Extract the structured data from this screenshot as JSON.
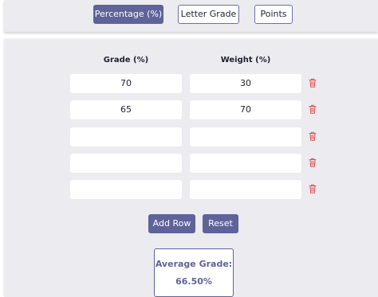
{
  "modes": {
    "percentage": "Percentage (%)",
    "letter": "Letter Grade",
    "points": "Points"
  },
  "columns": {
    "grade": "Grade (%)",
    "weight": "Weight (%)"
  },
  "rows": [
    {
      "grade": "70",
      "weight": "30"
    },
    {
      "grade": "65",
      "weight": "70"
    },
    {
      "grade": "",
      "weight": ""
    },
    {
      "grade": "",
      "weight": ""
    },
    {
      "grade": "",
      "weight": ""
    }
  ],
  "actions": {
    "add_row": "Add Row",
    "reset": "Reset"
  },
  "result": {
    "label": "Average Grade:",
    "value": "66.50%"
  },
  "colors": {
    "accent": "#5f6399",
    "panel": "#ebebf0",
    "delete": "#e05252"
  },
  "icons": {
    "delete": "trash-icon"
  }
}
